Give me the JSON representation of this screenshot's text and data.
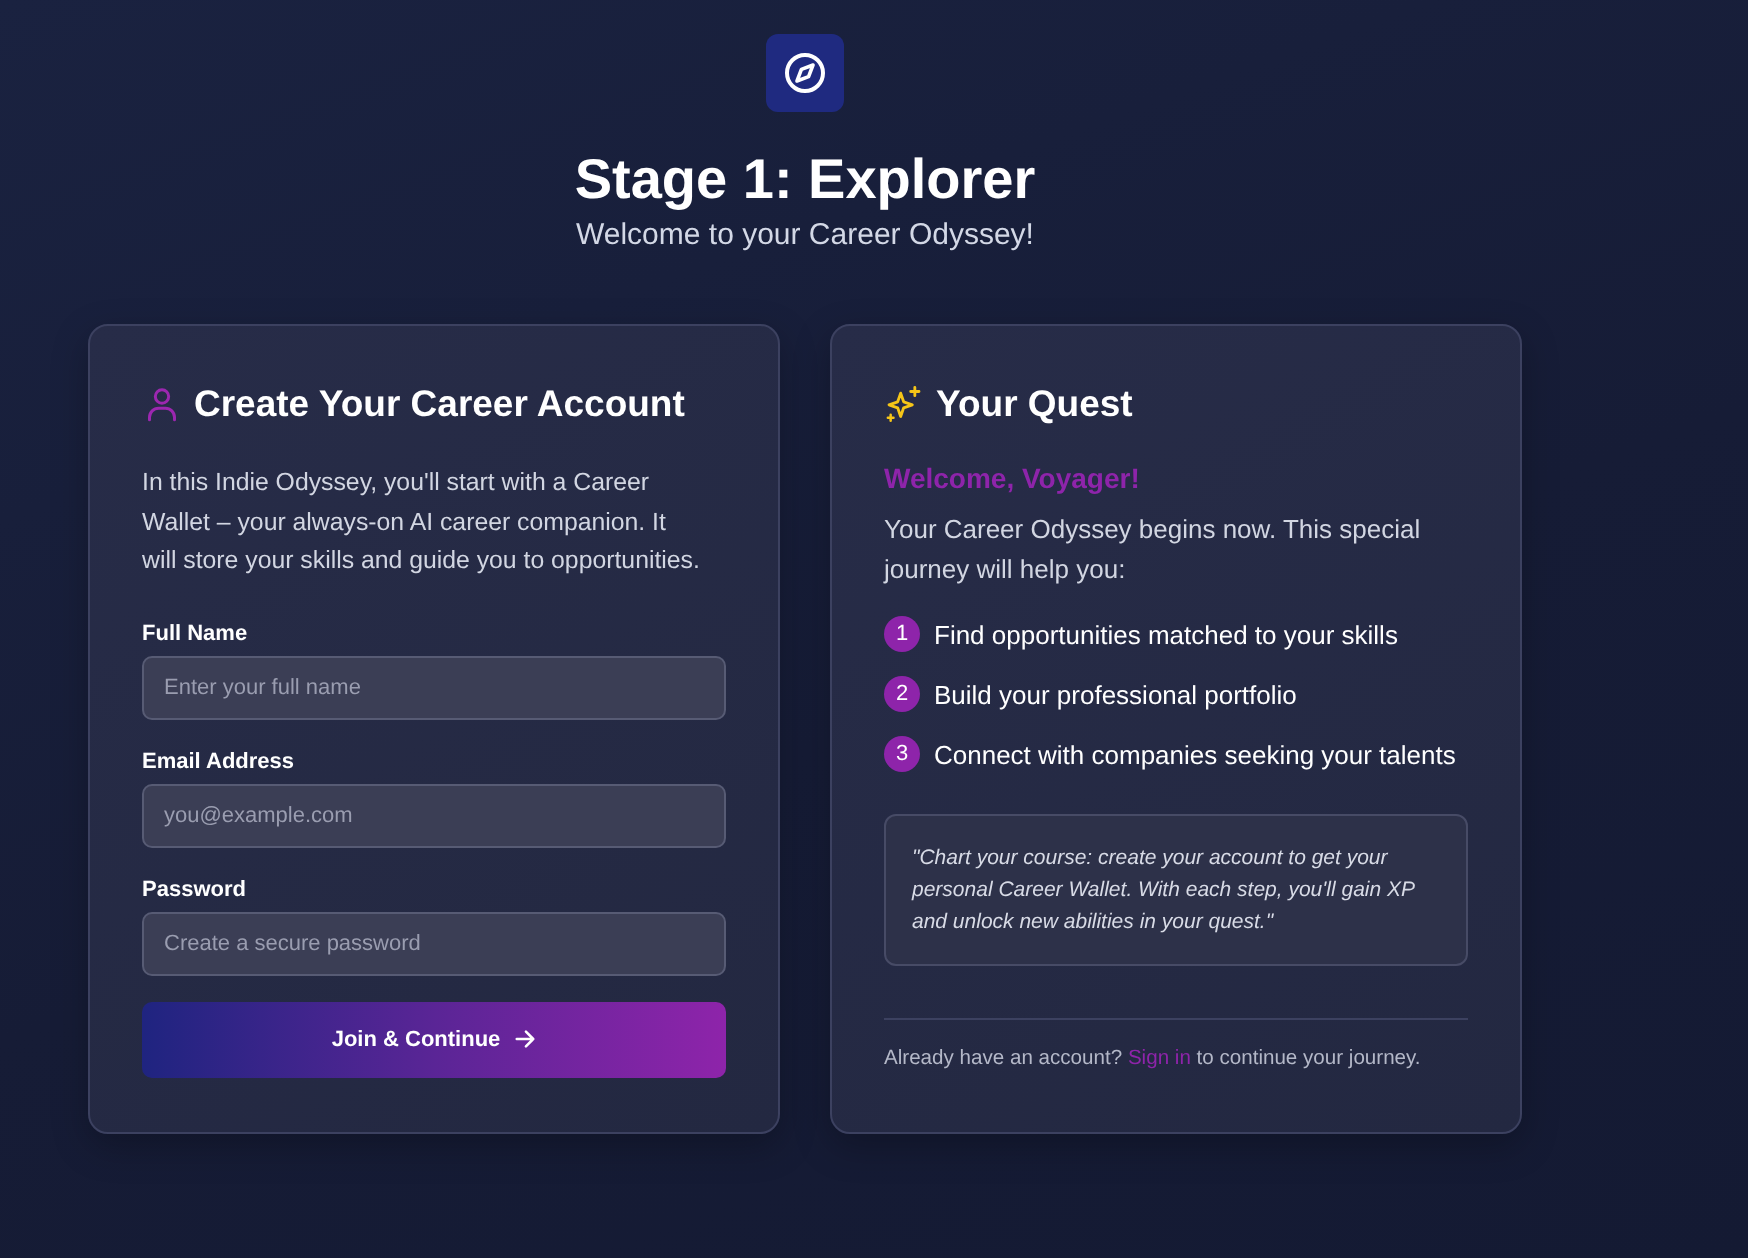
{
  "header": {
    "title": "Stage 1: Explorer",
    "subtitle": "Welcome to your Career Odyssey!"
  },
  "account_card": {
    "title": "Create Your Career Account",
    "intro": "In this Indie Odyssey, you'll start with a Career Wallet – your always-on AI career companion. It will store your skills and guide you to opportunities.",
    "fields": [
      {
        "label": "Full Name",
        "placeholder": "Enter your full name"
      },
      {
        "label": "Email Address",
        "placeholder": "you@example.com"
      },
      {
        "label": "Password",
        "placeholder": "Create a secure password"
      }
    ],
    "submit_button": "Join & Continue"
  },
  "quest_card": {
    "title": "Your Quest",
    "greeting": "Welcome, Voyager!",
    "intro": "Your Career Odyssey begins now. This special journey will help you:",
    "steps": [
      {
        "number": "1",
        "text": "Find opportunities matched to your skills"
      },
      {
        "number": "2",
        "text": "Build your professional portfolio"
      },
      {
        "number": "3",
        "text": "Connect with companies seeking your talents"
      }
    ],
    "quote": "\"Chart your course: create your account to get your personal Career Wallet. With each step, you'll gain XP and unlock new abilities in your quest.\"",
    "footer": {
      "before": "Already have an account?",
      "link": "Sign in",
      "after": "to continue your journey."
    }
  }
}
